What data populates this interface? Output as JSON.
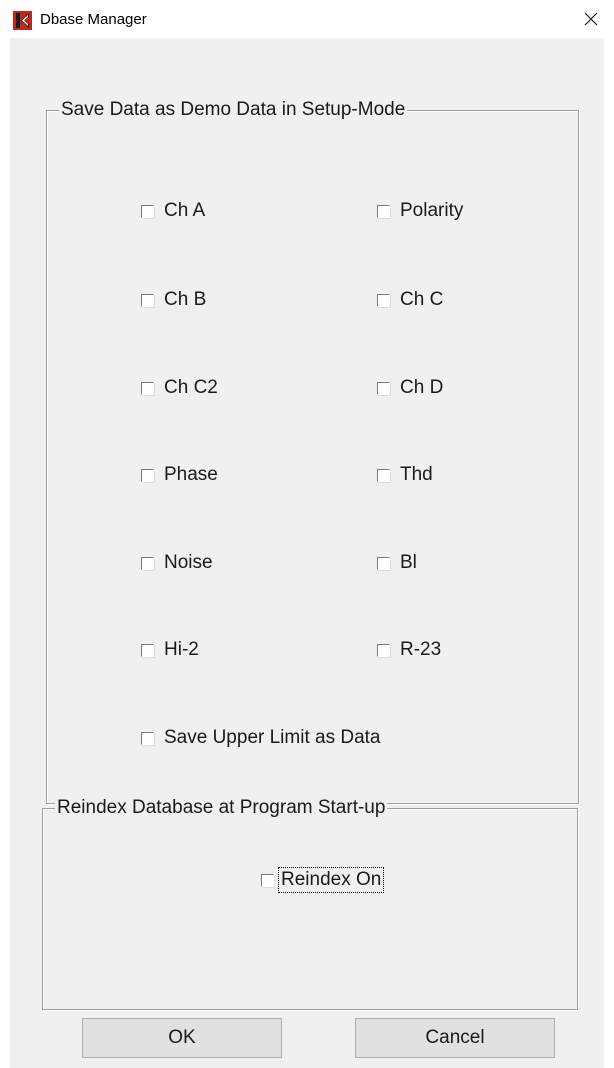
{
  "window": {
    "title": "Dbase Manager",
    "close_glyph": "×",
    "app_icon": "app-logo-icon",
    "accent_color": "#c0281f"
  },
  "demo_data_group": {
    "label": "Save Data as Demo Data in Setup-Mode",
    "checkboxes": [
      {
        "label": "Ch A",
        "checked": false
      },
      {
        "label": "Polarity",
        "checked": false
      },
      {
        "label": "Ch B",
        "checked": false
      },
      {
        "label": "Ch C",
        "checked": false
      },
      {
        "label": "Ch C2",
        "checked": false
      },
      {
        "label": "Ch D",
        "checked": false
      },
      {
        "label": "Phase",
        "checked": false
      },
      {
        "label": "Thd",
        "checked": false
      },
      {
        "label": "Noise",
        "checked": false
      },
      {
        "label": "Bl",
        "checked": false
      },
      {
        "label": "Hi-2",
        "checked": false
      },
      {
        "label": "R-23",
        "checked": false
      }
    ],
    "upper_limit": {
      "label": "Save Upper Limit as Data",
      "checked": false
    }
  },
  "reindex_group": {
    "label": "Reindex Database at Program Start-up",
    "reindex_on": {
      "label": "Reindex On",
      "checked": false
    }
  },
  "buttons": {
    "ok_label": "OK",
    "cancel_label": "Cancel"
  }
}
